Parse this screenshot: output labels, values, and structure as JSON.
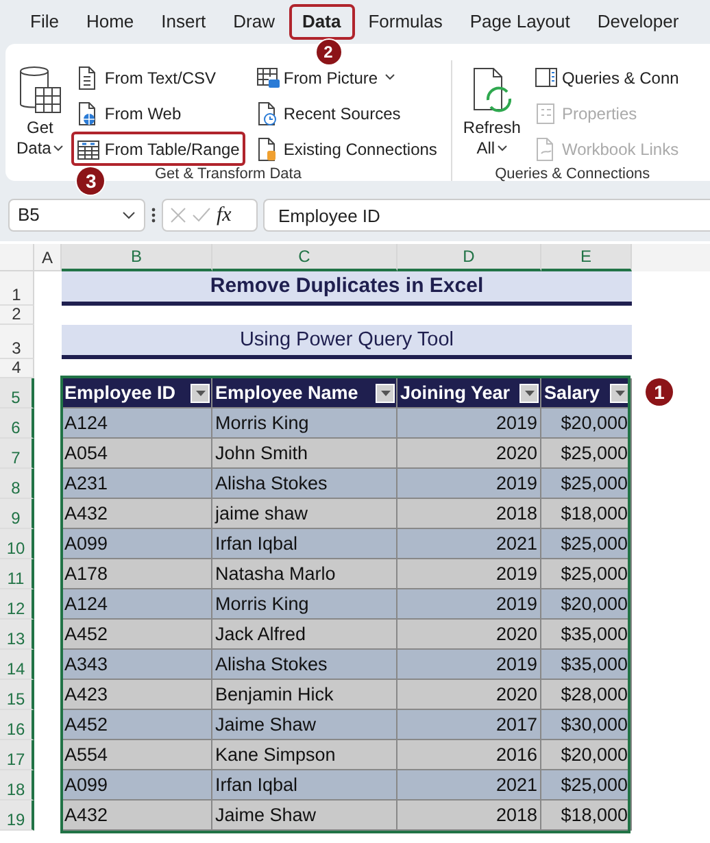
{
  "menu_tabs": [
    {
      "label": "File",
      "selected": false,
      "highlighted": false
    },
    {
      "label": "Home",
      "selected": false,
      "highlighted": false
    },
    {
      "label": "Insert",
      "selected": false,
      "highlighted": false
    },
    {
      "label": "Draw",
      "selected": false,
      "highlighted": false
    },
    {
      "label": "Data",
      "selected": true,
      "highlighted": true,
      "callout": "2"
    },
    {
      "label": "Formulas",
      "selected": false,
      "highlighted": false
    },
    {
      "label": "Page Layout",
      "selected": false,
      "highlighted": false
    },
    {
      "label": "Developer",
      "selected": false,
      "highlighted": false
    }
  ],
  "ribbon": {
    "groups": [
      {
        "label": "Get & Transform Data",
        "large": {
          "label": "Get",
          "label_2": "Data",
          "dropdown": true,
          "kind": "database"
        },
        "columns": [
          [
            {
              "label": "From Text/CSV",
              "kind": "text",
              "disabled": false,
              "dropdown": false,
              "highlighted": false
            },
            {
              "label": "From Web",
              "kind": "web",
              "disabled": false,
              "dropdown": false,
              "highlighted": false
            },
            {
              "label": "From Table/Range",
              "kind": "table",
              "disabled": false,
              "dropdown": false,
              "highlighted": true,
              "callout": "3"
            }
          ],
          [
            {
              "label": "From Picture",
              "kind": "picture",
              "disabled": false,
              "dropdown": true,
              "highlighted": false
            },
            {
              "label": "Recent Sources",
              "kind": "recent",
              "disabled": false,
              "dropdown": false,
              "highlighted": false
            },
            {
              "label": "Existing Connections",
              "kind": "existing",
              "disabled": false,
              "dropdown": false,
              "highlighted": false
            }
          ]
        ]
      },
      {
        "label": "Queries & Connections",
        "large": {
          "label": "Refresh",
          "label_2": "All",
          "dropdown": true,
          "kind": "refresh"
        },
        "columns": [
          [
            {
              "label": "Queries & Conn",
              "kind": "queries",
              "disabled": false,
              "dropdown": false,
              "highlighted": false
            },
            {
              "label": "Properties",
              "kind": "properties",
              "disabled": true,
              "dropdown": false,
              "highlighted": false
            },
            {
              "label": "Workbook Links",
              "kind": "links",
              "disabled": true,
              "dropdown": false,
              "highlighted": false
            }
          ]
        ]
      }
    ]
  },
  "formula_bar": {
    "name_box": "B5",
    "function_symbol": "fx",
    "value": "Employee ID"
  },
  "sheet": {
    "columns": [
      {
        "label": "A",
        "selected": false
      },
      {
        "label": "B",
        "selected": true
      },
      {
        "label": "C",
        "selected": true
      },
      {
        "label": "D",
        "selected": true
      },
      {
        "label": "E",
        "selected": true
      }
    ],
    "rows": [
      {
        "number": "1",
        "kind": "title",
        "selected": false,
        "text": "Remove Duplicates in Excel"
      },
      {
        "number": "2",
        "kind": "spacer",
        "selected": false
      },
      {
        "number": "3",
        "kind": "subtitle",
        "selected": false,
        "text": "Using Power Query Tool"
      },
      {
        "number": "4",
        "kind": "spacer",
        "selected": false
      },
      {
        "number": "5",
        "kind": "header",
        "selected": true,
        "callout": "1",
        "cells": [
          "Employee ID",
          "Employee Name",
          "Joining Year",
          "Salary"
        ]
      },
      {
        "number": "6",
        "kind": "data",
        "selected": true,
        "cells": [
          "A124",
          "Morris King",
          "2019",
          "$20,000"
        ]
      },
      {
        "number": "7",
        "kind": "data",
        "selected": true,
        "cells": [
          "A054",
          "John Smith",
          "2020",
          "$25,000"
        ]
      },
      {
        "number": "8",
        "kind": "data",
        "selected": true,
        "cells": [
          "A231",
          "Alisha Stokes",
          "2019",
          "$25,000"
        ]
      },
      {
        "number": "9",
        "kind": "data",
        "selected": true,
        "cells": [
          "A432",
          "jaime shaw",
          "2018",
          "$18,000"
        ]
      },
      {
        "number": "10",
        "kind": "data",
        "selected": true,
        "cells": [
          "A099",
          "Irfan Iqbal",
          "2021",
          "$25,000"
        ]
      },
      {
        "number": "11",
        "kind": "data",
        "selected": true,
        "cells": [
          "A178",
          "Natasha Marlo",
          "2019",
          "$25,000"
        ]
      },
      {
        "number": "12",
        "kind": "data",
        "selected": true,
        "cells": [
          "A124",
          "Morris King",
          "2019",
          "$20,000"
        ]
      },
      {
        "number": "13",
        "kind": "data",
        "selected": true,
        "cells": [
          "A452",
          "Jack Alfred",
          "2020",
          "$35,000"
        ]
      },
      {
        "number": "14",
        "kind": "data",
        "selected": true,
        "cells": [
          "A343",
          "Alisha Stokes",
          "2019",
          "$35,000"
        ]
      },
      {
        "number": "15",
        "kind": "data",
        "selected": true,
        "cells": [
          "A423",
          "Benjamin Hick",
          "2020",
          "$28,000"
        ]
      },
      {
        "number": "16",
        "kind": "data",
        "selected": true,
        "cells": [
          "A452",
          "Jaime Shaw",
          "2017",
          "$30,000"
        ]
      },
      {
        "number": "17",
        "kind": "data",
        "selected": true,
        "cells": [
          "A554",
          "Kane Simpson",
          "2016",
          "$20,000"
        ]
      },
      {
        "number": "18",
        "kind": "data",
        "selected": true,
        "cells": [
          "A099",
          "Irfan Iqbal",
          "2021",
          "$25,000"
        ]
      },
      {
        "number": "19",
        "kind": "data",
        "selected": true,
        "cells": [
          "A432",
          "Jaime Shaw",
          "2018",
          "$18,000"
        ]
      }
    ]
  }
}
